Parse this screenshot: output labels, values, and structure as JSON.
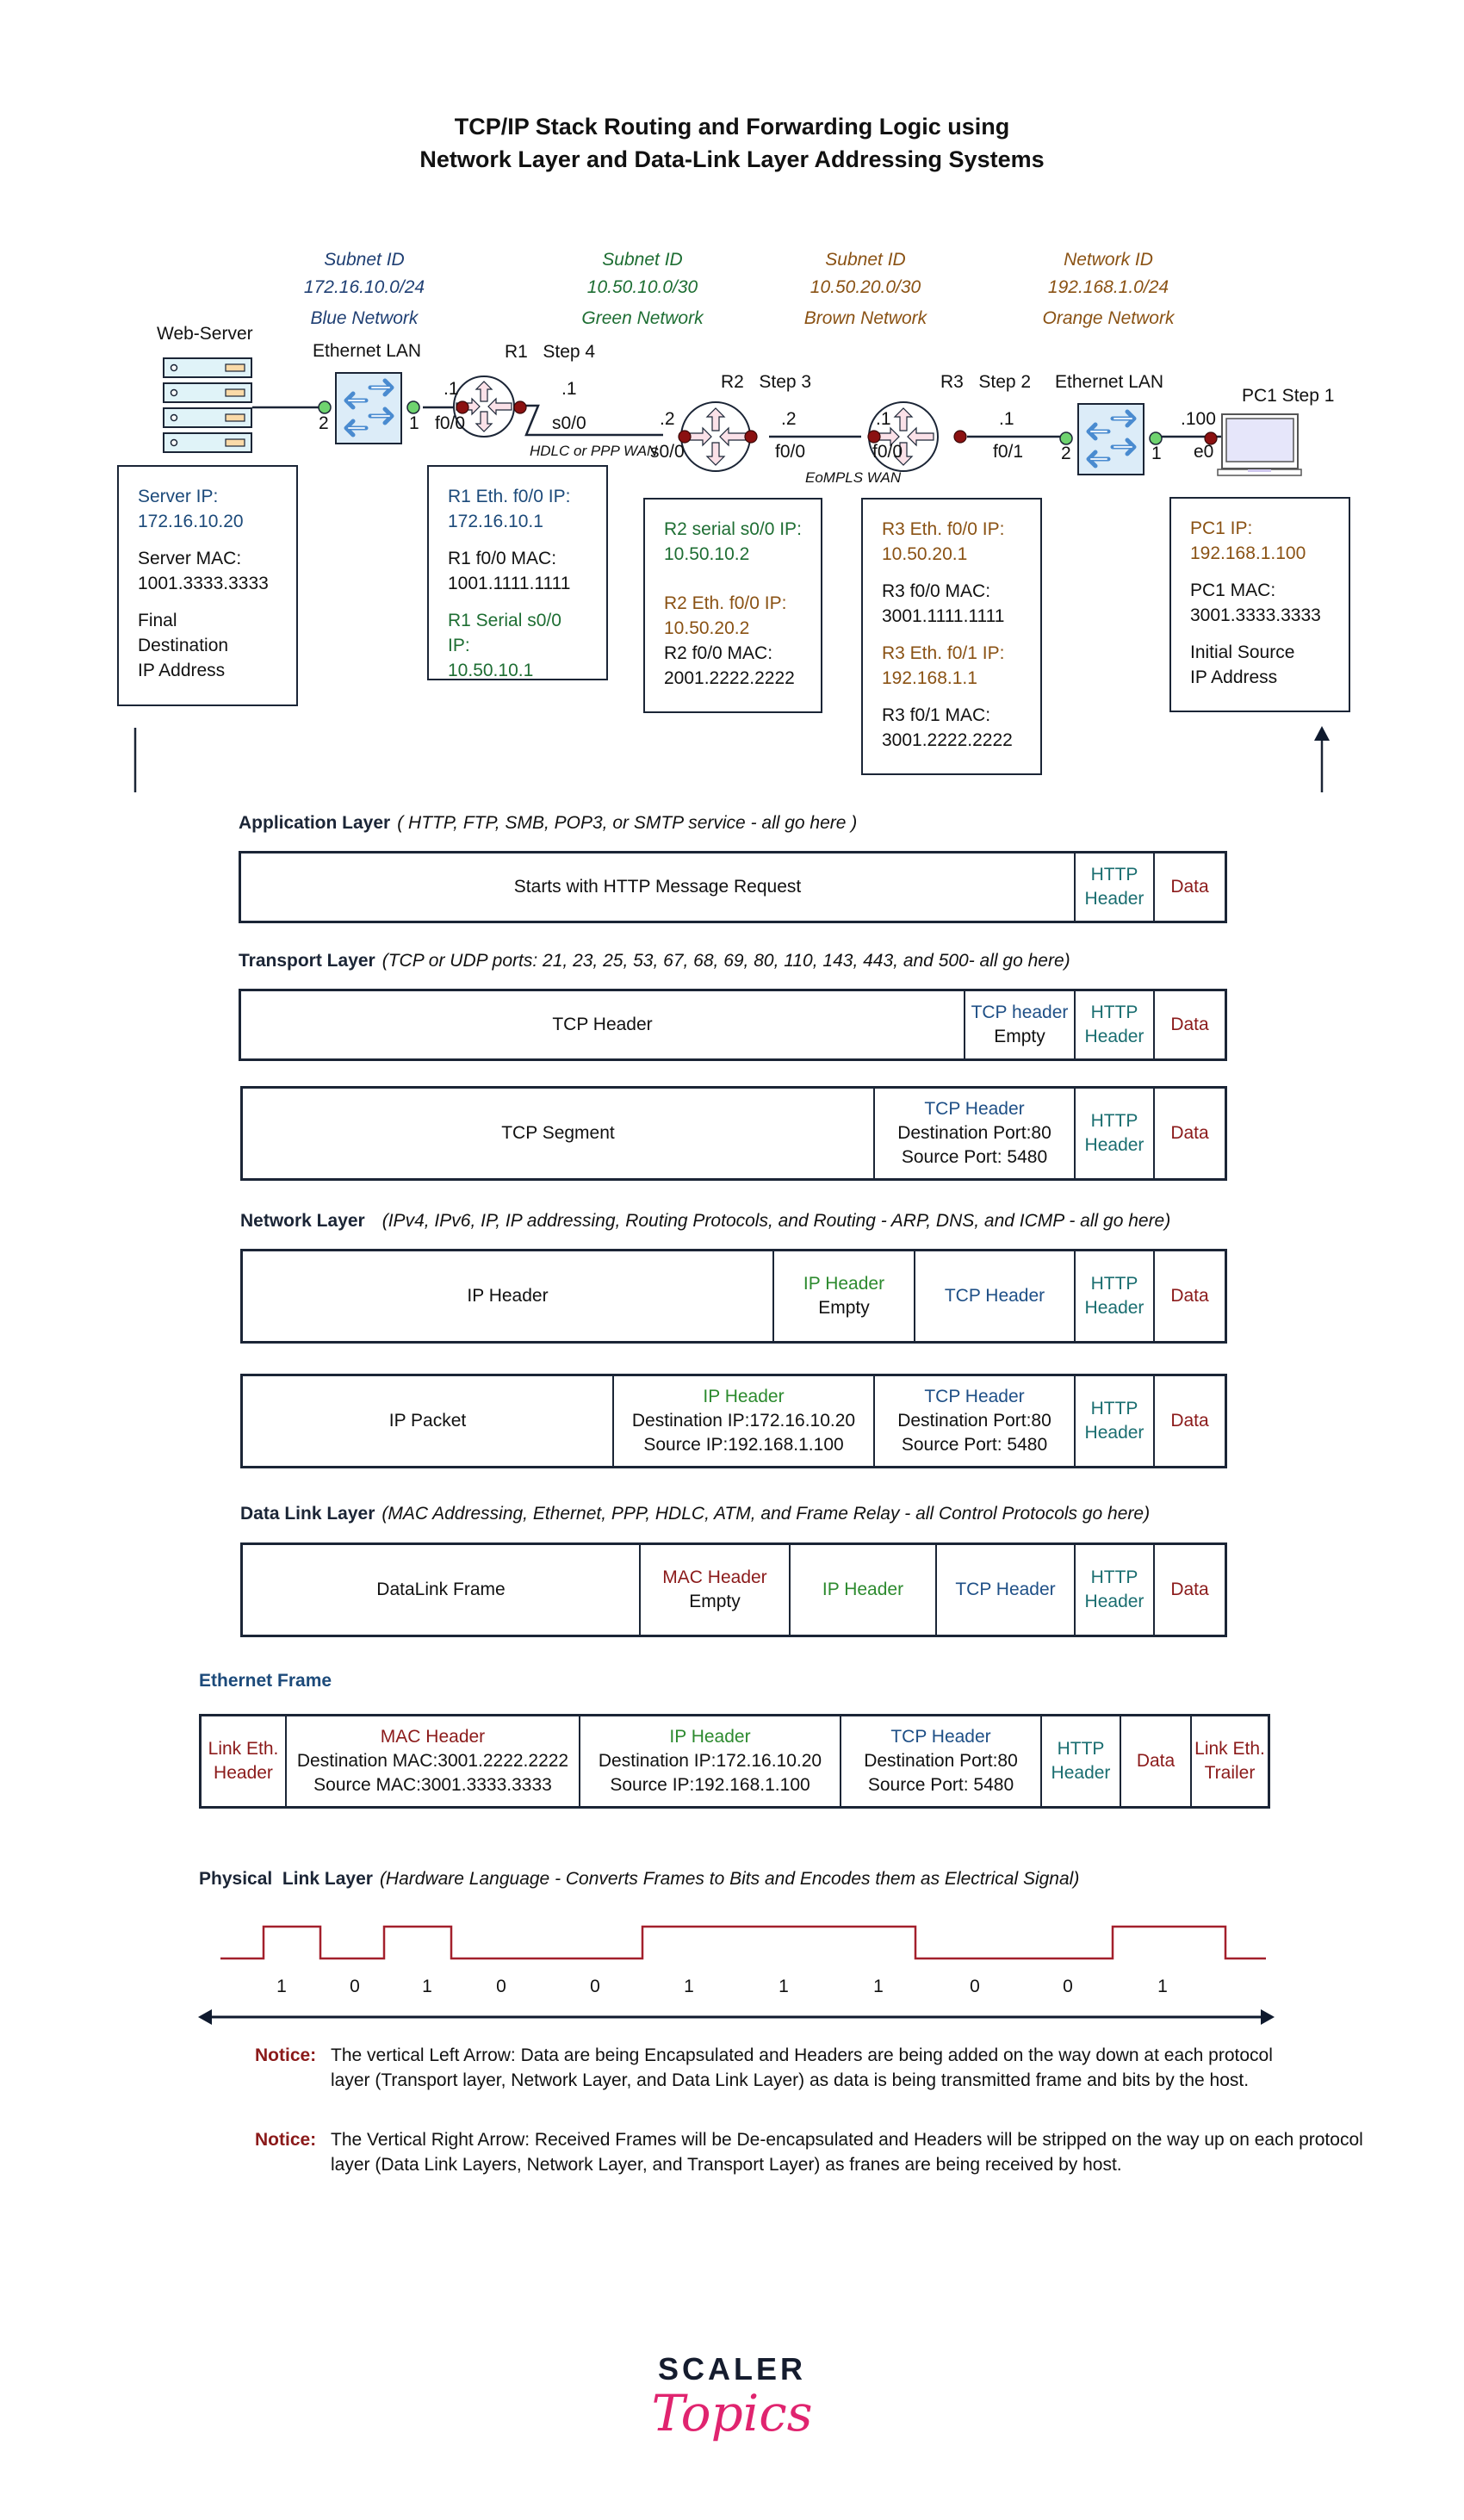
{
  "title": {
    "line1": "TCP/IP Stack Routing and Forwarding Logic using",
    "line2": "Network Layer and Data-Link Layer Addressing Systems"
  },
  "colors": {
    "blue_network": "#1f3f73",
    "green_network": "#1e6e33",
    "brown_network": "#8a5214",
    "data_red": "#8b1a1a",
    "http_teal": "#1a6e70",
    "tcp_blue": "#1e4f86",
    "ip_green": "#2c8a2e",
    "signal": "#a3202c",
    "logo_pink": "#e0246f"
  },
  "networks": [
    {
      "label": "Subnet ID",
      "id": "172.16.10.0/24",
      "name": "Blue Network"
    },
    {
      "label": "Subnet ID",
      "id": "10.50.10.0/30",
      "name": "Green Network"
    },
    {
      "label": "Subnet ID",
      "id": "10.50.20.0/30",
      "name": "Brown Network"
    },
    {
      "label": "Network ID",
      "id": "192.168.1.0/24",
      "name": "Orange Network"
    }
  ],
  "devices": {
    "server": "Web-Server",
    "switch1": "Ethernet LAN",
    "r1": "R1   Step 4",
    "r2": "R2   Step 3",
    "r3": "R3   Step 2",
    "switch2": "Ethernet LAN",
    "pc1": "PC1 Step 1"
  },
  "ports": {
    "sw1_left": "2",
    "sw1_right": "1",
    "r1_f00_host": ".1",
    "r1_f00": "f0/0",
    "r1_s00_host": ".1",
    "r1_s00": "s0/0",
    "wan1": "HDLC or PPP WAN",
    "r2_s00_host": ".2",
    "r2_s00": "s0/0",
    "r2_f00_host": ".2",
    "r2_f00": "f0/0",
    "wan2": "EoMPLS WAN",
    "r3_f00_host": ".1",
    "r3_f00": "f0/0",
    "r3_f01_host": ".1",
    "r3_f01": "f0/1",
    "sw2_left": "2",
    "sw2_right": "1",
    "pc_host": ".100",
    "pc_e0": "e0"
  },
  "boxes": {
    "server": {
      "ip_label": "Server IP:",
      "ip": "172.16.10.20",
      "mac_label": "Server MAC:",
      "mac": "1001.3333.3333",
      "note1": "Final",
      "note2": "Destination",
      "note3": "IP Address"
    },
    "r1": {
      "eth_label": "R1 Eth. f0/0 IP:",
      "eth_ip": "172.16.10.1",
      "mac_label": "R1 f0/0 MAC:",
      "mac": "1001.1111.1111",
      "serial_label": "R1 Serial s0/0 IP:",
      "serial_ip": "10.50.10.1"
    },
    "r2": {
      "serial_label": "R2 serial s0/0 IP:",
      "serial_ip": "10.50.10.2",
      "eth_label": "R2 Eth. f0/0 IP:",
      "eth_ip": "10.50.20.2",
      "mac_label": "R2 f0/0 MAC:",
      "mac": "2001.2222.2222"
    },
    "r3": {
      "f00_label": "R3 Eth. f0/0 IP:",
      "f00_ip": "10.50.20.1",
      "f00_mac_label": "R3 f0/0 MAC:",
      "f00_mac": "3001.1111.1111",
      "f01_label": "R3 Eth. f0/1 IP:",
      "f01_ip": "192.168.1.1",
      "f01_mac_label": "R3 f0/1 MAC:",
      "f01_mac": "3001.2222.2222"
    },
    "pc1": {
      "ip_label": "PC1 IP:",
      "ip": "192.168.1.100",
      "mac_label": "PC1 MAC:",
      "mac": "3001.3333.3333",
      "note1": "Initial Source",
      "note2": "IP Address"
    }
  },
  "layers": {
    "application": {
      "name": "Application Layer",
      "desc": "( HTTP, FTP, SMB, POP3, or SMTP service - all go here )",
      "row": {
        "main": "Starts with HTTP Message Request",
        "http1": "HTTP",
        "http2": "Header",
        "data": "Data"
      }
    },
    "transport": {
      "name": "Transport Layer",
      "desc": "(TCP or UDP ports: 21, 23, 25, 53, 67, 68, 69, 80, 110, 143, 443, and 500- all go here)",
      "row1": {
        "main": "TCP Header",
        "tcp1": "TCP header",
        "tcp2": "Empty",
        "http1": "HTTP",
        "http2": "Header",
        "data": "Data"
      },
      "row2": {
        "main": "TCP Segment",
        "tcp1": "TCP Header",
        "tcp2": "Destination Port:80",
        "tcp3": "Source Port: 5480",
        "http1": "HTTP",
        "http2": "Header",
        "data": "Data"
      }
    },
    "network": {
      "name": "Network Layer",
      "desc": "(IPv4, IPv6, IP, IP addressing, Routing Protocols, and Routing - ARP, DNS, and ICMP - all go here)",
      "row1": {
        "main": "IP Header",
        "ip1": "IP Header",
        "ip2": "Empty",
        "tcp": "TCP Header",
        "http1": "HTTP",
        "http2": "Header",
        "data": "Data"
      },
      "row2": {
        "main": "IP Packet",
        "ip1": "IP Header",
        "ip2": "Destination IP:172.16.10.20",
        "ip3": "Source IP:192.168.1.100",
        "tcp1": "TCP Header",
        "tcp2": "Destination Port:80",
        "tcp3": "Source Port: 5480",
        "http1": "HTTP",
        "http2": "Header",
        "data": "Data"
      }
    },
    "datalink": {
      "name": "Data Link Layer",
      "desc": "(MAC Addressing, Ethernet, PPP, HDLC, ATM, and Frame Relay - all Control Protocols go here)",
      "row": {
        "main": "DataLink Frame",
        "mac1": "MAC Header",
        "mac2": "Empty",
        "ip": "IP Header",
        "tcp": "TCP Header",
        "http1": "HTTP",
        "http2": "Header",
        "data": "Data"
      }
    },
    "ethernet": {
      "name": "Ethernet Frame",
      "row": {
        "lh1": "Link Eth.",
        "lh2": "Header",
        "mac1": "MAC Header",
        "mac2": "Destination MAC:3001.2222.2222",
        "mac3": "Source MAC:3001.3333.3333",
        "ip1": "IP Header",
        "ip2": "Destination IP:172.16.10.20",
        "ip3": "Source IP:192.168.1.100",
        "tcp1": "TCP Header",
        "tcp2": "Destination Port:80",
        "tcp3": "Source Port: 5480",
        "http1": "HTTP",
        "http2": "Header",
        "data": "Data",
        "lt1": "Link Eth.",
        "lt2": "Trailer"
      }
    },
    "physical": {
      "name": "Physical  Link Layer",
      "desc": "(Hardware Language - Converts Frames to Bits and Encodes them as Electrical Signal)",
      "bits": [
        "1",
        "0",
        "1",
        "0",
        "0",
        "1",
        "1",
        "1",
        "0",
        "0",
        "1"
      ]
    }
  },
  "notices": [
    {
      "label": "Notice:",
      "text": "The vertical Left Arrow: Data are being Encapsulated and Headers are being added on the way down at each protocol layer (Transport layer, Network Layer, and Data Link Layer) as data is being transmitted frame and bits by the host."
    },
    {
      "label": "Notice:",
      "text": "The Vertical Right Arrow: Received Frames will be De-encapsulated and Headers will be stripped on the way up on each protocol layer (Data Link Layers, Network Layer, and Transport Layer) as franes are being received by host."
    }
  ],
  "logo": {
    "line1": "SCALER",
    "line2": "Topics"
  }
}
